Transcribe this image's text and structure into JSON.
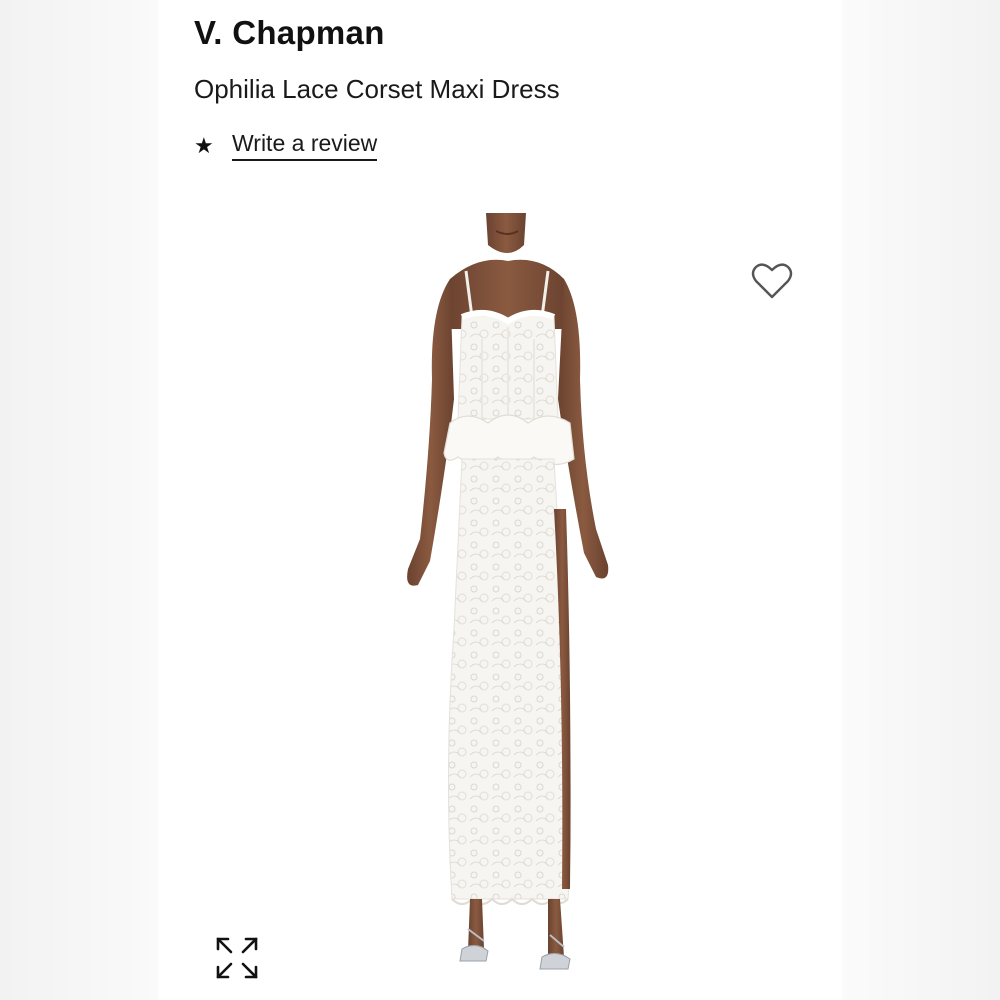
{
  "product": {
    "brand": "V. Chapman",
    "name": "Ophilia Lace Corset Maxi Dress"
  },
  "rating": {
    "star_icon": "star-icon",
    "review_label": "Write a review"
  },
  "image": {
    "alt": "Model wearing white lace corset maxi dress",
    "wishlist_icon": "heart-outline-icon",
    "expand_icon": "expand-arrows-icon"
  },
  "colors": {
    "background": "#ffffff",
    "side_blur": "#f4f4f4",
    "text": "#1a1a1a",
    "icon_stroke": "#555555"
  }
}
